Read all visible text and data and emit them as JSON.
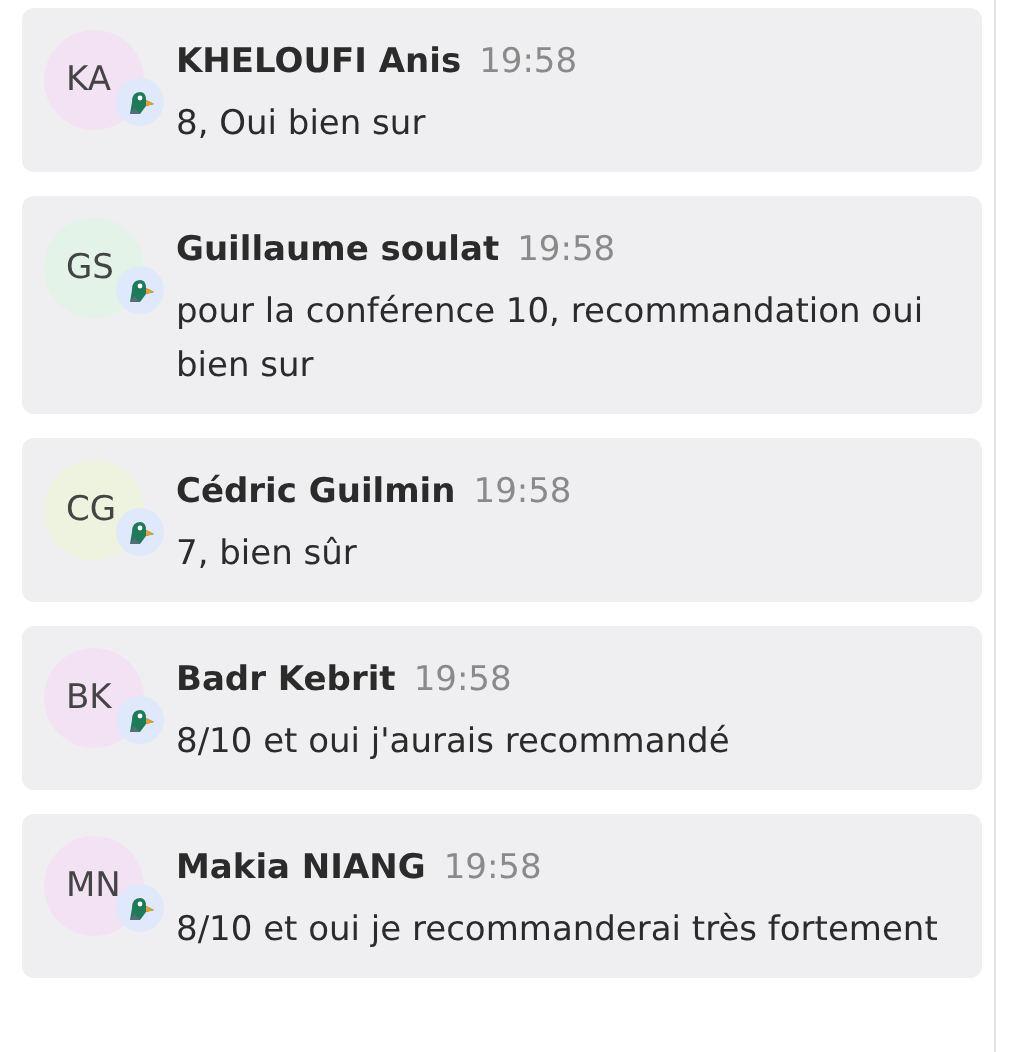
{
  "messages": [
    {
      "initials": "KA",
      "color": "#f3e2f3",
      "author": "KHELOUFI Anis",
      "time": "19:58",
      "text": "8, Oui bien sur"
    },
    {
      "initials": "GS",
      "color": "#e3f3e8",
      "author": "Guillaume soulat",
      "time": "19:58",
      "text": "pour la conférence 10, recommandation oui bien sur"
    },
    {
      "initials": "CG",
      "color": "#edf3df",
      "author": "Cédric Guilmin",
      "time": "19:58",
      "text": "7, bien sûr"
    },
    {
      "initials": "BK",
      "color": "#f3e2f3",
      "author": "Badr Kebrit",
      "time": "19:58",
      "text": "8/10 et oui j'aurais recommandé"
    },
    {
      "initials": "MN",
      "color": "#f3e2f3",
      "author": "Makia NIANG",
      "time": "19:58",
      "text": "8/10 et oui je recommanderai très fortement"
    }
  ]
}
